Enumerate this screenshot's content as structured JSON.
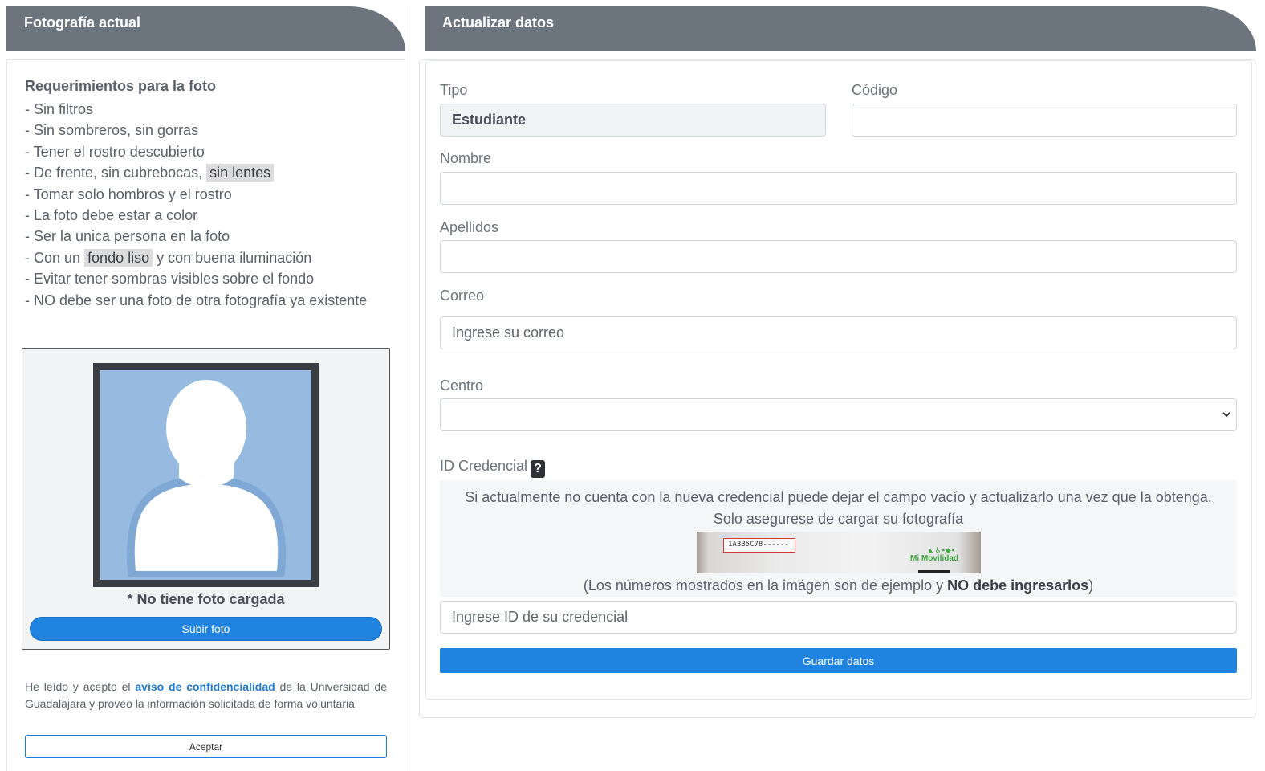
{
  "photo_panel": {
    "title": "Fotografía actual",
    "requirements_title": "Requerimientos para la foto",
    "requirements": {
      "r1": "- Sin filtros",
      "r2": "- Sin sombreros, sin gorras",
      "r3": "- Tener el rostro descubierto",
      "r4_pre": "- De frente, sin cubrebocas, ",
      "r4_hl": "sin lentes",
      "r5": "- Tomar solo hombros y el rostro",
      "r6": "- La foto debe estar a color",
      "r7": "- Ser la unica persona en la foto",
      "r8_pre": "- Con un ",
      "r8_hl": "fondo liso",
      "r8_post": " y con buena iluminación",
      "r9": "- Evitar tener sombras visibles sobre el fondo",
      "r10": "- NO debe ser una foto de otra fotografía ya existente"
    },
    "no_photo_text": "* No tiene foto cargada",
    "upload_button": "Subir foto",
    "consent_pre": "He leído y acepto el ",
    "consent_link": "aviso de confidencialidad",
    "consent_post": " de la Universidad de Guadalajara y proveo la información solicitada de forma voluntaria",
    "accept_button": "Aceptar"
  },
  "form_panel": {
    "title": "Actualizar datos",
    "tipo_label": "Tipo",
    "tipo_value": "Estudiante",
    "codigo_label": "Código",
    "codigo_value": "",
    "nombre_label": "Nombre",
    "nombre_value": "",
    "apellidos_label": "Apellidos",
    "apellidos_value": "",
    "correo_label": "Correo",
    "correo_placeholder": "Ingrese su correo",
    "centro_label": "Centro",
    "centro_value": "",
    "credencial_label": "ID Credencial",
    "help_glyph": "?",
    "credencial_info": "Si actualmente no cuenta con la nueva credencial puede dejar el campo vacío y actualizarlo una vez que la obtenga. Solo asegurese de cargar su fotografía",
    "card_example_code": "1A3B5C78------",
    "card_brand": "Mi Movilidad",
    "example_note_pre": "(Los números mostrados en la imágen son de ejemplo y ",
    "example_note_bold": "NO debe ingresarlos",
    "example_note_post": ")",
    "credencial_placeholder": "Ingrese ID de su credencial",
    "save_button": "Guardar datos"
  },
  "colors": {
    "header_bg": "#6c757d",
    "primary": "#1f83df",
    "avatar_bg": "#97bbe0",
    "frame": "#3a3d42"
  }
}
